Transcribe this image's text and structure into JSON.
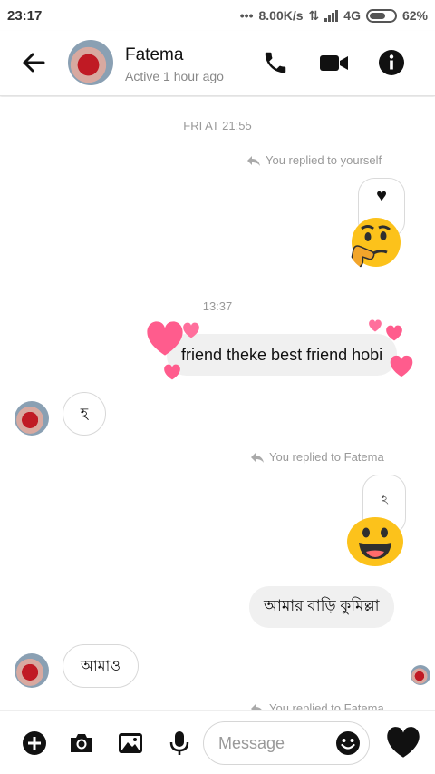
{
  "status_bar": {
    "time": "23:17",
    "net_speed": "8.00K/s",
    "network": "4G",
    "battery": "62%"
  },
  "header": {
    "name": "Fatema",
    "status": "Active 1 hour ago",
    "icons": [
      "back-arrow-icon",
      "phone-icon",
      "video-icon",
      "info-icon"
    ]
  },
  "messages": {
    "timestamp_1": "FRI AT 21:55",
    "reply_note_1": "You replied to yourself",
    "quoted_1": "♥",
    "timestamp_2": "13:37",
    "sent_text_1": "friend theke best friend hobi",
    "received_1": "হ",
    "reply_note_2": "You replied to Fatema",
    "quoted_2": "হ",
    "sent_text_2": "আমার বাড়ি কুমিল্লা",
    "received_2": "আমাও",
    "reply_note_3": "You replied to Fatema"
  },
  "composer": {
    "placeholder": "Message",
    "icons": [
      "plus-icon",
      "camera-icon",
      "gallery-icon",
      "mic-icon",
      "emoji-icon",
      "heart-like-icon"
    ]
  },
  "colors": {
    "accent": "#000000",
    "heart_pink": "#ff5c8d",
    "emoji_yellow": "#fcc21b"
  }
}
